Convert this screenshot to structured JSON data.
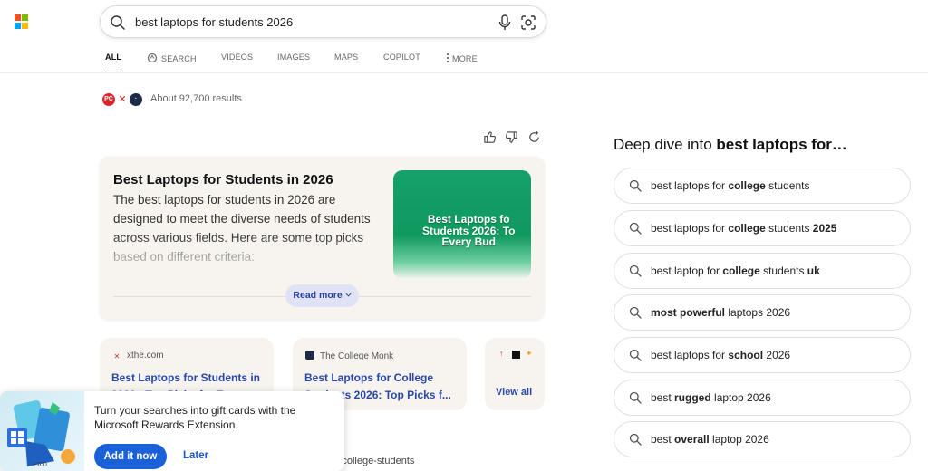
{
  "search": {
    "query": "best laptops for students 2026"
  },
  "tabs": [
    {
      "label": "ALL"
    },
    {
      "label": "SEARCH"
    },
    {
      "label": "VIDEOS"
    },
    {
      "label": "IMAGES"
    },
    {
      "label": "MAPS"
    },
    {
      "label": "COPILOT"
    },
    {
      "label": "MORE"
    }
  ],
  "results": {
    "count_text": "About 92,700 results"
  },
  "answer": {
    "title": "Best Laptops for Students in 2026",
    "body": "The best laptops for students in 2026 are designed to meet the diverse needs of students across various fields. Here are some top picks based on different criteria:",
    "thumbnail_text": "Best Laptops fo\nStudents 2026: To\nEvery Bud",
    "read_more": "Read more"
  },
  "sources": [
    {
      "host": "xthe.com",
      "title": "Best Laptops for Students in 2026 - Top Picks for Every"
    },
    {
      "host": "The College Monk",
      "title": "Best Laptops for College Students 2026: Top Picks f..."
    }
  ],
  "view_all": "View all",
  "partial_url": "r-college-students",
  "promo": {
    "message": "Turn your searches into gift cards with the Microsoft Rewards Extension.",
    "add_label": "Add it now",
    "later_label": "Later",
    "badge": "+100"
  },
  "deep_dive": {
    "title_prefix": "Deep dive into ",
    "title_bold": "best laptops for…",
    "items": [
      {
        "pre": "best laptops for ",
        "b1": "college",
        "mid": " students",
        "b2": ""
      },
      {
        "pre": "best laptops for ",
        "b1": "college",
        "mid": " students ",
        "b2": "2025"
      },
      {
        "pre": "best laptop for ",
        "b1": "college",
        "mid": " students ",
        "b2": "uk"
      },
      {
        "pre": "",
        "b1": "most powerful",
        "mid": " laptops 2026",
        "b2": ""
      },
      {
        "pre": "best laptops for ",
        "b1": "school",
        "mid": " 2026",
        "b2": ""
      },
      {
        "pre": "best ",
        "b1": "rugged",
        "mid": " laptop 2026",
        "b2": ""
      },
      {
        "pre": "best ",
        "b1": "overall",
        "mid": " laptop 2026",
        "b2": ""
      }
    ]
  },
  "colors": {
    "accent": "#1a60d8",
    "link": "#2a48a8",
    "card_bg": "#f7f4ef",
    "thumb_green": "#16a06a"
  },
  "icons": [
    "microsoft-logo-icon",
    "search-icon",
    "microphone-icon",
    "visual-search-icon",
    "thumbs-up-icon",
    "thumbs-down-icon",
    "refresh-icon",
    "chevron-down-icon",
    "more-dots-icon"
  ]
}
